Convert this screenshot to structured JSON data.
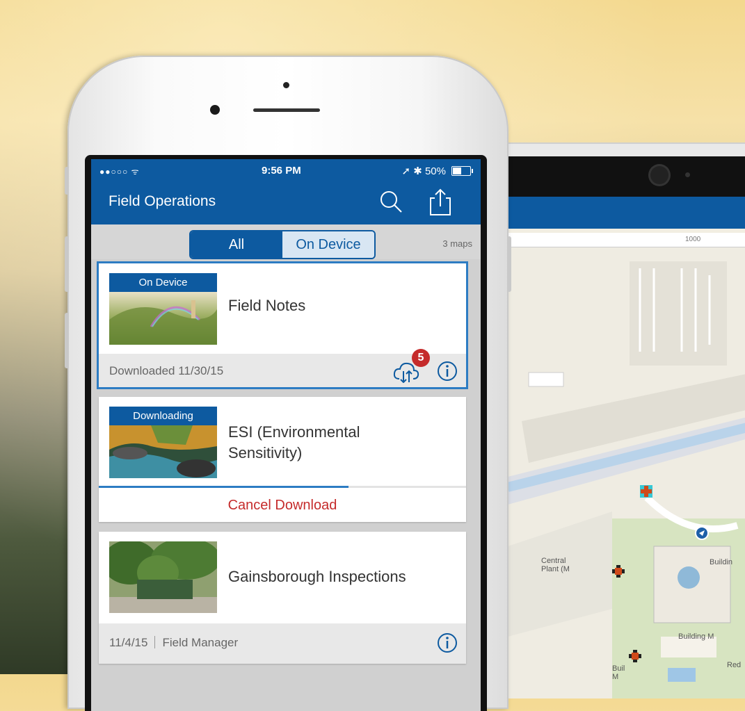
{
  "status_bar": {
    "signal": "●●○○○",
    "time": "9:56 PM",
    "battery": "50%",
    "battery_fraction": 0.5
  },
  "nav": {
    "title": "Field Operations",
    "search_icon": "search-icon",
    "share_icon": "share-icon"
  },
  "filter": {
    "tabs": [
      {
        "label": "All",
        "selected": true
      },
      {
        "label": "On Device",
        "selected": false
      }
    ],
    "count": "3 maps"
  },
  "maps": [
    {
      "badge": "On Device",
      "title": "Field Notes",
      "footer": "Downloaded 11/30/15",
      "sync_count": "5",
      "selected": true
    },
    {
      "badge": "Downloading",
      "title_line1": "ESI (Environmental",
      "title_line2": "Sensitivity)",
      "progress": 0.68,
      "action": "Cancel Download"
    },
    {
      "title": "Gainsborough Inspections",
      "date": "11/4/15",
      "owner": "Field Manager"
    }
  ],
  "tablet_map": {
    "scale": "1000",
    "labels": [
      "Central",
      "Plant (M",
      "Buildin",
      "Building M",
      "Buil",
      "M",
      "Red"
    ]
  },
  "colors": {
    "accent": "#0d5aa0",
    "alert": "#c52b2b",
    "progress": "#2d7cc3"
  }
}
